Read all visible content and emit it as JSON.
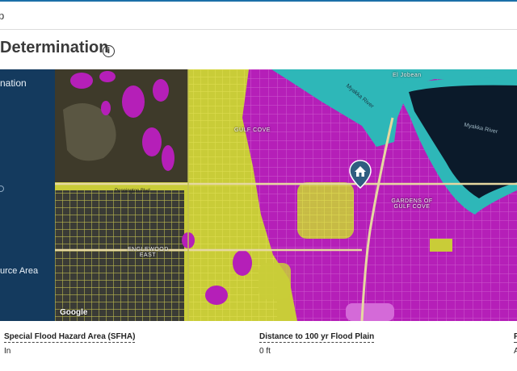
{
  "topbar": {
    "text": "p"
  },
  "section": {
    "title": "Determination",
    "info_icon": "info-icon"
  },
  "layer_panel": {
    "items": [
      "nation",
      "urce Area"
    ]
  },
  "map": {
    "place_labels": [
      "GULF COVE",
      "GARDENS OF GULF COVE",
      "ENGLEWOOD EAST",
      "El Jobean"
    ],
    "water_labels": [
      "Myakka River",
      "Myakka River"
    ],
    "road_labels": [
      "Pennington Blvd"
    ],
    "pin_icon": "home-pin-icon",
    "attribution": "Google"
  },
  "stats": [
    {
      "label": "Special Flood Hazard Area (SFHA)",
      "value": "In"
    },
    {
      "label": "Distance to 100 yr Flood Plain",
      "value": "0 ft"
    },
    {
      "label": "F",
      "value": "A"
    }
  ],
  "colors": {
    "panel": "#143a5e",
    "flood_high": "#b51fb8",
    "flood_moderate": "#c9cc38",
    "water": "#2eb7b8",
    "water_deep": "#0b1a2a"
  }
}
